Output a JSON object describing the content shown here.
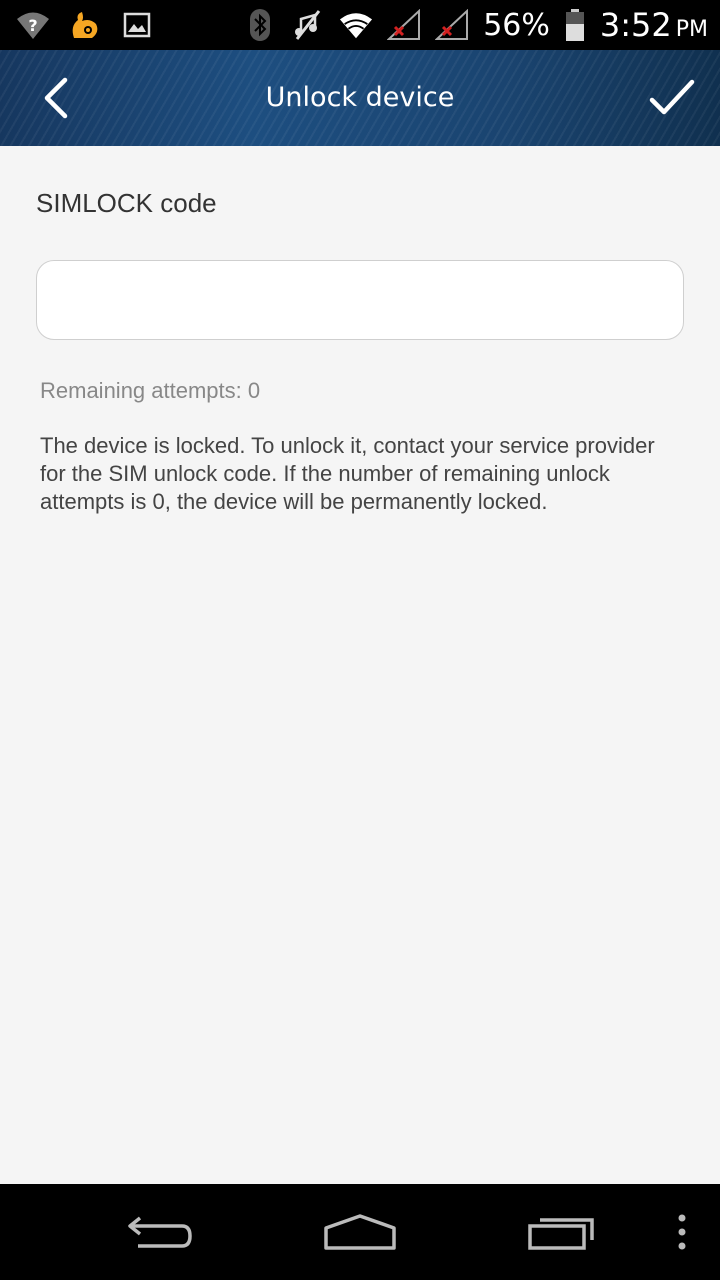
{
  "status_bar": {
    "battery_percent": "56%",
    "time": "3:52",
    "ampm": "PM",
    "icons": [
      "wifi-unknown-icon",
      "uc-browser-icon",
      "image-icon",
      "bluetooth-icon",
      "mute-icon",
      "wifi-icon",
      "signal-no-sim-icon",
      "signal-no-sim-icon",
      "battery-icon"
    ]
  },
  "action_bar": {
    "title": "Unlock device",
    "back_icon": "chevron-left-icon",
    "confirm_icon": "check-icon"
  },
  "form": {
    "label": "SIMLOCK code",
    "input_value": "",
    "input_placeholder": "",
    "remaining_attempts": "Remaining attempts: 0",
    "description": "The device is locked. To unlock it, contact your service provider for the SIM unlock code. If the number of remaining unlock attempts is 0, the device will be permanently locked."
  },
  "nav_bar": {
    "icons": [
      "back-nav-icon",
      "home-nav-icon",
      "recent-apps-icon",
      "overflow-menu-icon"
    ]
  },
  "colors": {
    "action_bar": "#1d4e80",
    "background": "#f5f5f5",
    "status_bar": "#000000"
  }
}
